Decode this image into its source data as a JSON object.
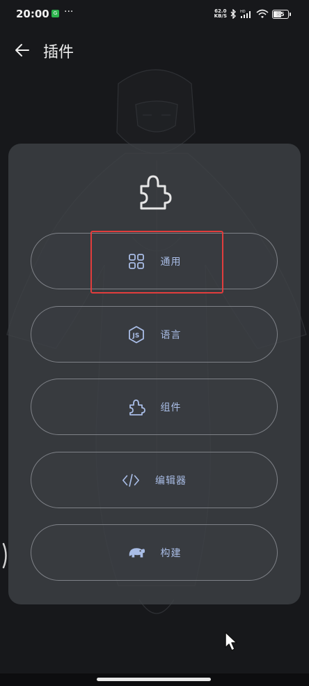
{
  "status_bar": {
    "time": "20:00",
    "app_badge": "G",
    "more": "···",
    "net_speed_value": "62.0",
    "net_speed_unit": "KB/S",
    "signal_label": "HD",
    "battery": "55"
  },
  "header": {
    "title": "插件"
  },
  "menu": {
    "items": [
      {
        "label": "通用",
        "icon": "grid-icon"
      },
      {
        "label": "语言",
        "icon": "nodejs-icon"
      },
      {
        "label": "组件",
        "icon": "puzzle-icon"
      },
      {
        "label": "编辑器",
        "icon": "code-icon"
      },
      {
        "label": "构建",
        "icon": "gradle-elephant-icon"
      }
    ]
  },
  "colors": {
    "background": "#17181b",
    "card": "#3f4247",
    "accent_text": "#a9bde6",
    "highlight": "#e23d3d"
  }
}
